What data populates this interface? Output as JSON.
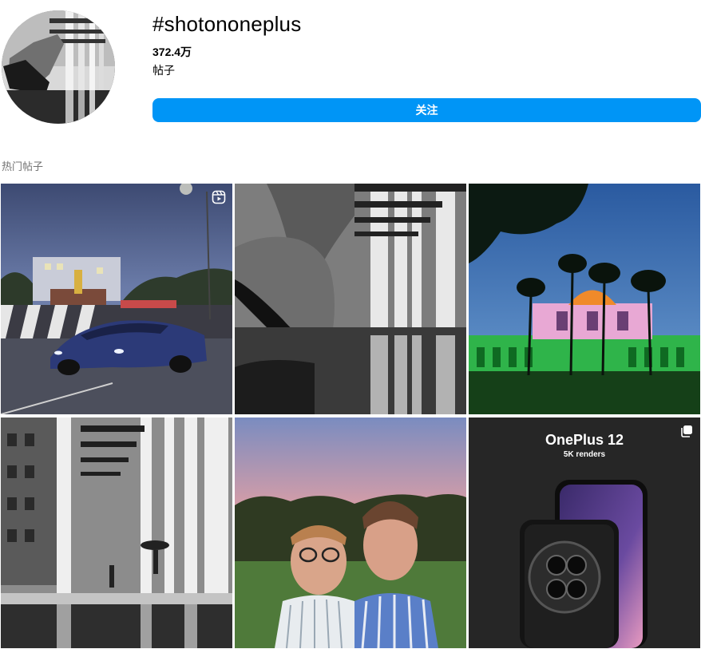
{
  "header": {
    "hashtag": "#shotononeplus",
    "post_count": "372.4万",
    "post_count_label": "帖子",
    "follow_label": "关注"
  },
  "section": {
    "title": "热门帖子"
  },
  "posts": [
    {
      "subject": "blue sports car on wet road at dusk",
      "badge": "reels-icon"
    },
    {
      "subject": "black and white sneaker step reflection"
    },
    {
      "subject": "illuminated monument with palm trees at night"
    },
    {
      "subject": "black and white colonnade with umbrella walker"
    },
    {
      "subject": "two men selfie at sunset park"
    },
    {
      "subject": "phone promo render",
      "badge": "carousel-icon",
      "title": "OnePlus 12",
      "subtitle": "5K renders"
    }
  ],
  "colors": {
    "accent": "#0095f6",
    "muted_text": "#737373"
  }
}
